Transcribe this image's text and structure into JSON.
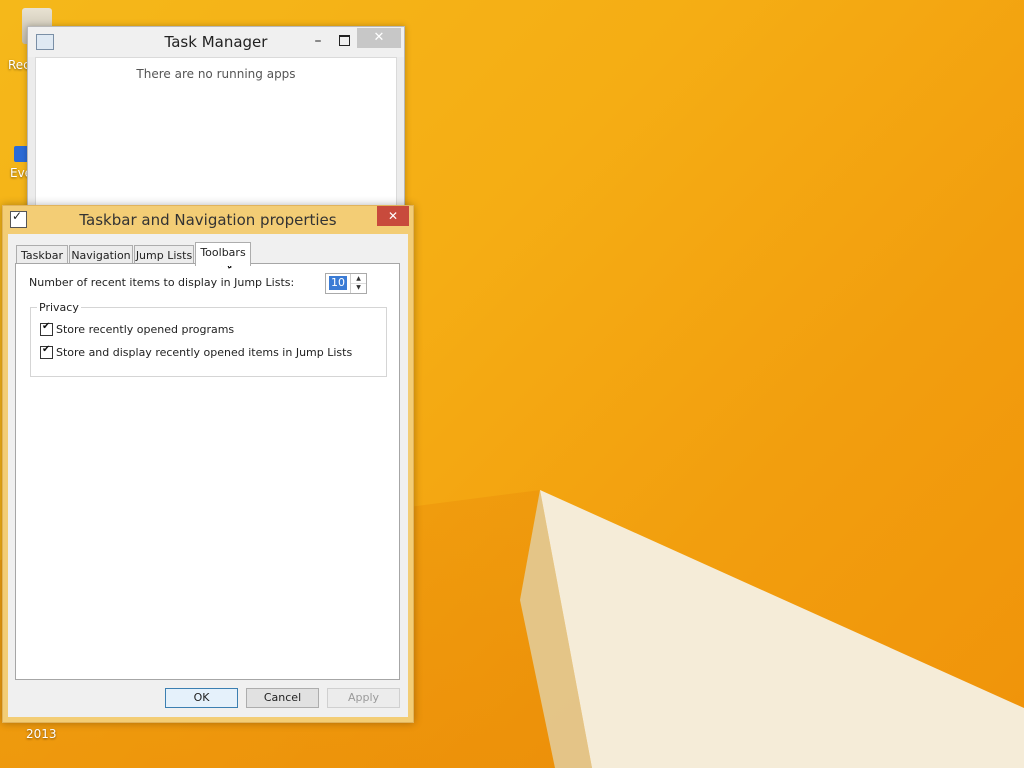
{
  "desktop": {
    "icons": [
      {
        "label": "Rec",
        "icon": "recycle-bin-icon"
      },
      {
        "label": "Eve",
        "icon": "shortcut-icon"
      },
      {
        "label": "2013",
        "icon": "file-icon"
      }
    ]
  },
  "task_manager": {
    "title": "Task Manager",
    "empty_message": "There are no running apps",
    "controls": {
      "minimize": "–",
      "close": "✕"
    }
  },
  "dialog": {
    "title": "Taskbar and Navigation properties",
    "close": "✕",
    "tabs": [
      {
        "label": "Taskbar",
        "active": false
      },
      {
        "label": "Navigation",
        "active": false
      },
      {
        "label": "Jump Lists",
        "active": false
      },
      {
        "label": "Toolbars",
        "active": true
      }
    ],
    "recent_items_label": "Number of recent items to display in Jump Lists:",
    "recent_items_value": "10",
    "privacy": {
      "legend": "Privacy",
      "options": [
        {
          "label": "Store recently opened programs",
          "checked": true
        },
        {
          "label": "Store and display recently opened items in Jump Lists",
          "checked": true
        }
      ]
    },
    "buttons": {
      "ok": "OK",
      "cancel": "Cancel",
      "apply": "Apply"
    }
  },
  "colors": {
    "desktop_orange": "#f5b81a",
    "dialog_frame": "#f3cd75",
    "close_red": "#c84a3c",
    "selection_blue": "#3a7bd5"
  }
}
